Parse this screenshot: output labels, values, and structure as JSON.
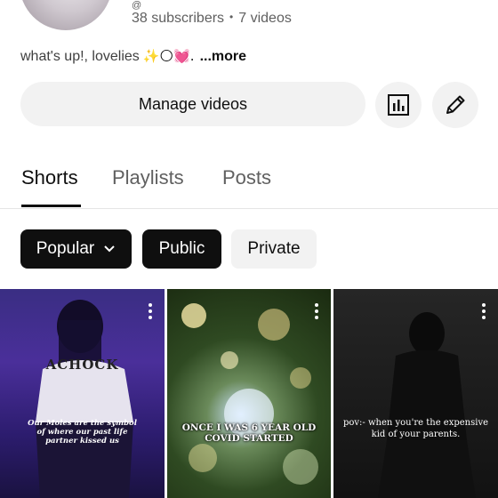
{
  "channel": {
    "handle_fragment": "@",
    "subscribers": "38 subscribers",
    "videos": "7 videos",
    "separator": "•",
    "bio": "what's up!, lovelies",
    "bio_emoji": "✨🌕💓.",
    "bio_more": "...more"
  },
  "actions": {
    "manage_label": "Manage videos",
    "analytics_icon": "analytics-bars-icon",
    "edit_icon": "pencil-icon"
  },
  "tabs": [
    {
      "label": "Shorts",
      "active": true
    },
    {
      "label": "Playlists",
      "active": false
    },
    {
      "label": "Posts",
      "active": false
    }
  ],
  "filters": {
    "sort_label": "Popular",
    "public_label": "Public",
    "private_label": "Private"
  },
  "shorts": [
    {
      "top_text": "ACHOCK",
      "caption": "Our Moles are the symbol of where our past life partner kissed us"
    },
    {
      "caption": "ONCE I WAS 6 YEAR OLD COVID STARTED"
    },
    {
      "caption": "pov:- when you're the expensive kid of your parents."
    }
  ],
  "colors": {
    "text_primary": "#0f0f0f",
    "text_secondary": "#606060",
    "chip_bg": "#f2f2f2"
  }
}
